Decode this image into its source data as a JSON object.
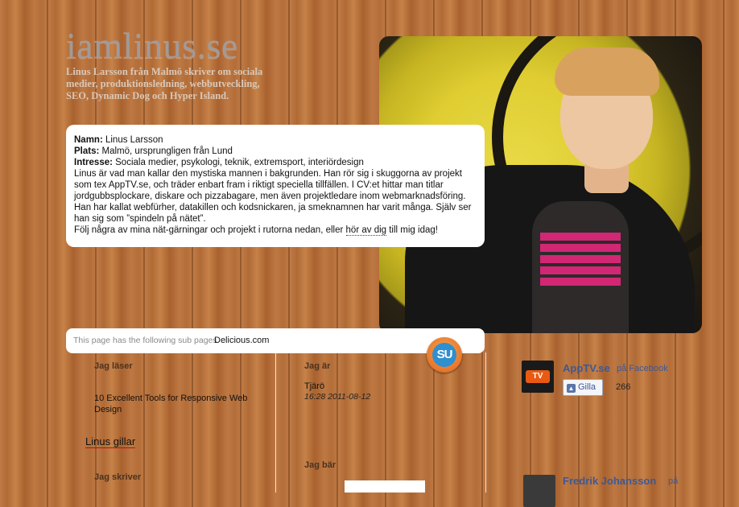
{
  "header": {
    "title": "iamlinus.se",
    "tagline": "Linus Larsson från Malmö skriver om sociala medier, produktionsledning, webbutveckling, SEO, Dynamic Dog och Hyper Island."
  },
  "profile": {
    "name_label": "Namn:",
    "name_value": " Linus Larsson",
    "place_label": "Plats:",
    "place_value": " Malmö, ursprungligen från Lund",
    "interest_label": "Intresse:",
    "interest_value": " Sociala medier, psykologi, teknik, extremsport, interiördesign",
    "bio": "Linus är vad man kallar den mystiska mannen i bakgrunden. Han rör sig i skuggorna av projekt som tex AppTV.se, och träder enbart fram i riktigt speciella tillfällen. I CV:et hittar man titlar jordgubbsplockare, diskare och pizzabagare, men även projektledare inom webmarknadsföring. Han har kallat webfürher, datakillen och kodsnickaren, ja smeknamnen har varit många. Själv ser han sig som ”spindeln på nätet”.",
    "follow_text": "Följ några av mina nät-gärningar och projekt i rutorna nedan, eller ",
    "follow_link": "hör av dig",
    "follow_end": " till mig idag!"
  },
  "subpages": {
    "note": "This page has the following sub pages.",
    "link": "Delicious.com"
  },
  "stumbleupon": {
    "label": "SU",
    "color": "#e8762b"
  },
  "left_column": {
    "reading_heading": "Jag läser",
    "reading_item": "10 Excellent Tools for Responsive Web Design",
    "likes_heading": "Linus gillar",
    "writing_heading": "Jag skriver"
  },
  "middle_column": {
    "location_heading": "Jag är",
    "location_value": "Tjärö",
    "location_time": "16:28 2011-08-12",
    "wearing_heading": "Jag bär"
  },
  "facebook": {
    "page_name": "AppTV.se",
    "page_suffix": " på Facebook",
    "thumb_label": "TV",
    "like_label": "Gilla",
    "like_count": "266",
    "person_name": "Fredrik Johansson",
    "person_suffix": " på"
  },
  "colors": {
    "facebook_blue": "#3b5998",
    "wood": "#b8713c"
  }
}
